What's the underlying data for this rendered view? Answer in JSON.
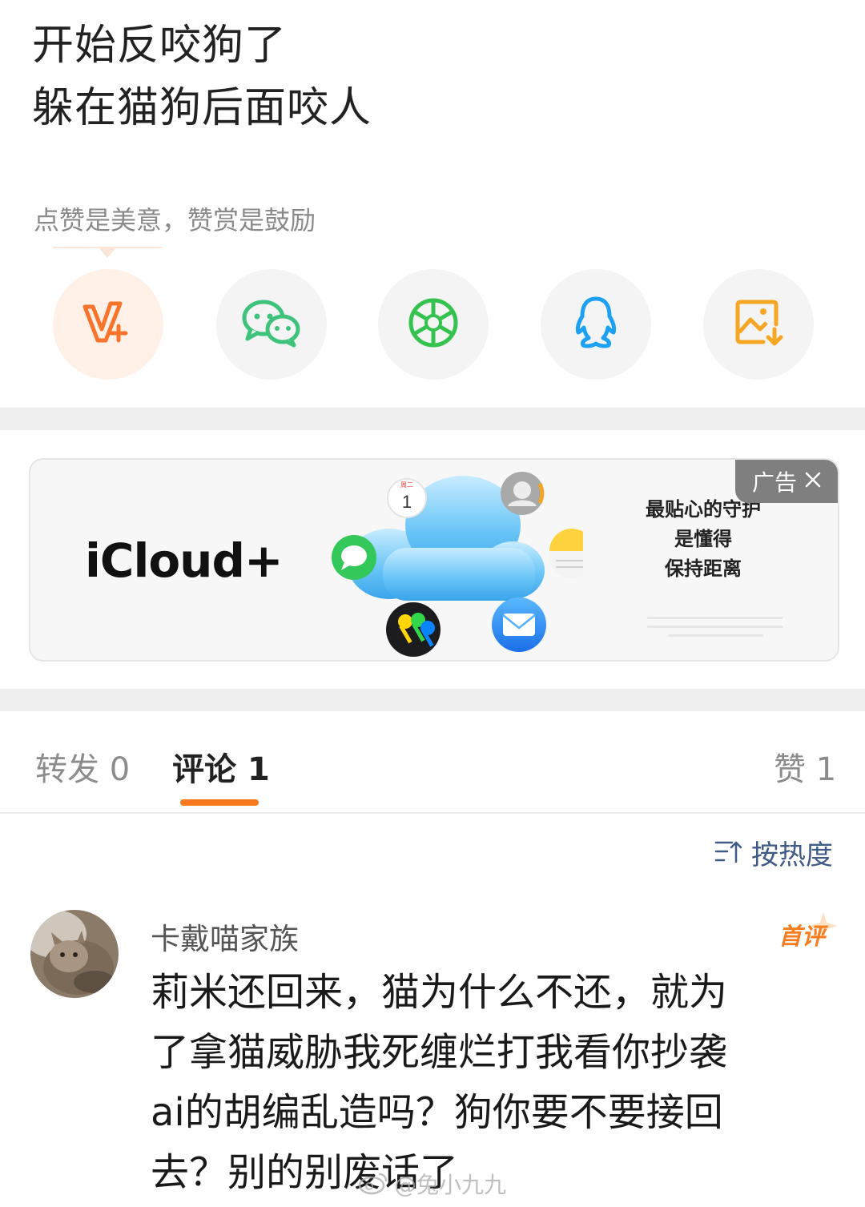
{
  "post": {
    "lines": [
      "开始反咬狗了",
      "躲在猫狗后面咬人"
    ],
    "reward_hint": "点赞是美意，赞赏是鼓励"
  },
  "share": {
    "buttons": [
      {
        "icon": "weibo-reward-icon",
        "color": "#f7742a"
      },
      {
        "icon": "wechat-icon",
        "color": "#3ec27c"
      },
      {
        "icon": "moments-icon",
        "color": "#35c24f"
      },
      {
        "icon": "qq-icon",
        "color": "#1da1f2"
      },
      {
        "icon": "save-image-icon",
        "color": "#f5a623"
      }
    ]
  },
  "ad": {
    "brand": "iCloud+",
    "slogan": [
      "最贴心的守护",
      "是懂得",
      "保持距离"
    ],
    "badge_label": "广告",
    "calendar_day": "1"
  },
  "tabs": {
    "items": [
      {
        "label": "转发",
        "count": "0"
      },
      {
        "label": "评论",
        "count": "1"
      },
      {
        "label": "赞",
        "count": "1"
      }
    ],
    "active_index": 1
  },
  "sort": {
    "label": "按热度"
  },
  "comment": {
    "user": "卡戴喵家族",
    "first_badge": "首评",
    "lines": [
      "莉米还回来，猫为什么不还，就为",
      "了拿猫威胁我死缠烂打我看你抄袭",
      "ai的胡编乱造吗？狗你要不要接回",
      "去？别的别废话了"
    ]
  },
  "watermark": "@兔小九九",
  "colors": {
    "accent": "#f8791d",
    "link": "#3e5a85",
    "divider": "#efefef"
  }
}
